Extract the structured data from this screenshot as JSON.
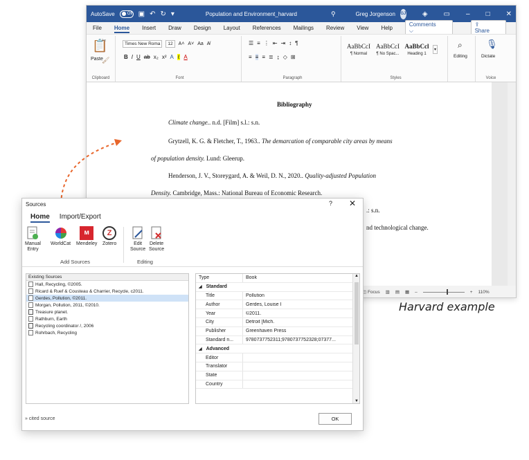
{
  "word": {
    "autosave_label": "AutoSave",
    "autosave_state": "Off",
    "doc_title": "Population and Environment_harvard",
    "user_name": "Greg Jorgenson",
    "user_initials": "GJ",
    "menu": [
      "File",
      "Home",
      "Insert",
      "Draw",
      "Design",
      "Layout",
      "References",
      "Mailings",
      "Review",
      "View",
      "Help"
    ],
    "comments_label": "Comments",
    "share_label": "Share",
    "ribbon": {
      "paste_label": "Paste",
      "clipboard_label": "Clipboard",
      "font_name": "Times New Roma",
      "font_size": "12",
      "font_label": "Font",
      "paragraph_label": "Paragraph",
      "styles": [
        {
          "sample": "AaBbCcI",
          "name": "¶ Normal"
        },
        {
          "sample": "AaBbCcI",
          "name": "¶ No Spac..."
        },
        {
          "sample": "AaBbCcl",
          "name": "Heading 1"
        }
      ],
      "styles_label": "Styles",
      "editing_label": "Editing",
      "dictate_label": "Dictate",
      "voice_label": "Voice"
    },
    "document": {
      "heading": "Bibliography",
      "entry1_title": "Climate change.",
      "entry1_rest": ". n.d. [Film] s.l.: s.n.",
      "entry2_authors": "Grytzell, K. G. & Fletcher, T., 1963.. ",
      "entry2_title_a": "The demarcation of comparable city areas by means",
      "entry2_title_b": "of population density.",
      "entry2_rest": " Lund: Gleerup.",
      "entry3_authors": "Henderson, J. V., Storeygard, A. & Weil, D. N., 2020.. ",
      "entry3_title_a": "Quality-adjusted Population",
      "entry3_title_b": "Density.",
      "entry3_rest": " Cambridge, Mass.: National Bureau of Economic Research.",
      "entry4_partial": ".: s.n.",
      "entry5_partial": "nd technological change."
    },
    "status": {
      "focus": "Focus",
      "zoom": "110%"
    }
  },
  "caption": "Harvard example",
  "dialog": {
    "title": "Sources",
    "help": "?",
    "tabs": [
      "Home",
      "Import/Export"
    ],
    "tools": [
      {
        "label1": "Manual",
        "label2": "Entry"
      },
      {
        "label1": "WorldCat",
        "label2": ""
      },
      {
        "label1": "Mendeley",
        "label2": ""
      },
      {
        "label1": "Zotero",
        "label2": ""
      },
      {
        "label1": "Edit",
        "label2": "Source"
      },
      {
        "label1": "Delete",
        "label2": "Source"
      }
    ],
    "add_sources_label": "Add Sources",
    "editing_label": "Editing",
    "sources_header": "Existing Sources",
    "sources": [
      "Hall, Recycling, ©2005.",
      "Ricard & Ruef & Cousteau & Charrier, Recycle, c2011.",
      "Gerdes, Pollution, ©2011.",
      "Morgan, Pollution, 2011, ©2010.",
      "Treasure planet.",
      "Rathburn, Earth",
      "Recycling coordinator /, 2006",
      "Rohrbach, Recycling"
    ],
    "props_header": {
      "k": "Type",
      "v": "Book"
    },
    "standard_label": "Standard",
    "standard": [
      {
        "k": "Title",
        "v": "Pollution"
      },
      {
        "k": "Author",
        "v": "Gerdes, Louise I"
      },
      {
        "k": "Year",
        "v": "©2011."
      },
      {
        "k": "City",
        "v": "Detroit [Mich."
      },
      {
        "k": "Publisher",
        "v": "Greenhaven Press"
      },
      {
        "k": "Standard n...",
        "v": "9780737752311;9780737752328;07377..."
      }
    ],
    "advanced_label": "Advanced",
    "advanced": [
      {
        "k": "Editor",
        "v": ""
      },
      {
        "k": "Translator",
        "v": ""
      },
      {
        "k": "State",
        "v": ""
      },
      {
        "k": "Country",
        "v": ""
      }
    ],
    "footer": "» cited source",
    "ok_label": "OK"
  },
  "colors": {
    "word_blue": "#2b579a",
    "arrow": "#e8662b",
    "mendeley": "#d7262e"
  }
}
